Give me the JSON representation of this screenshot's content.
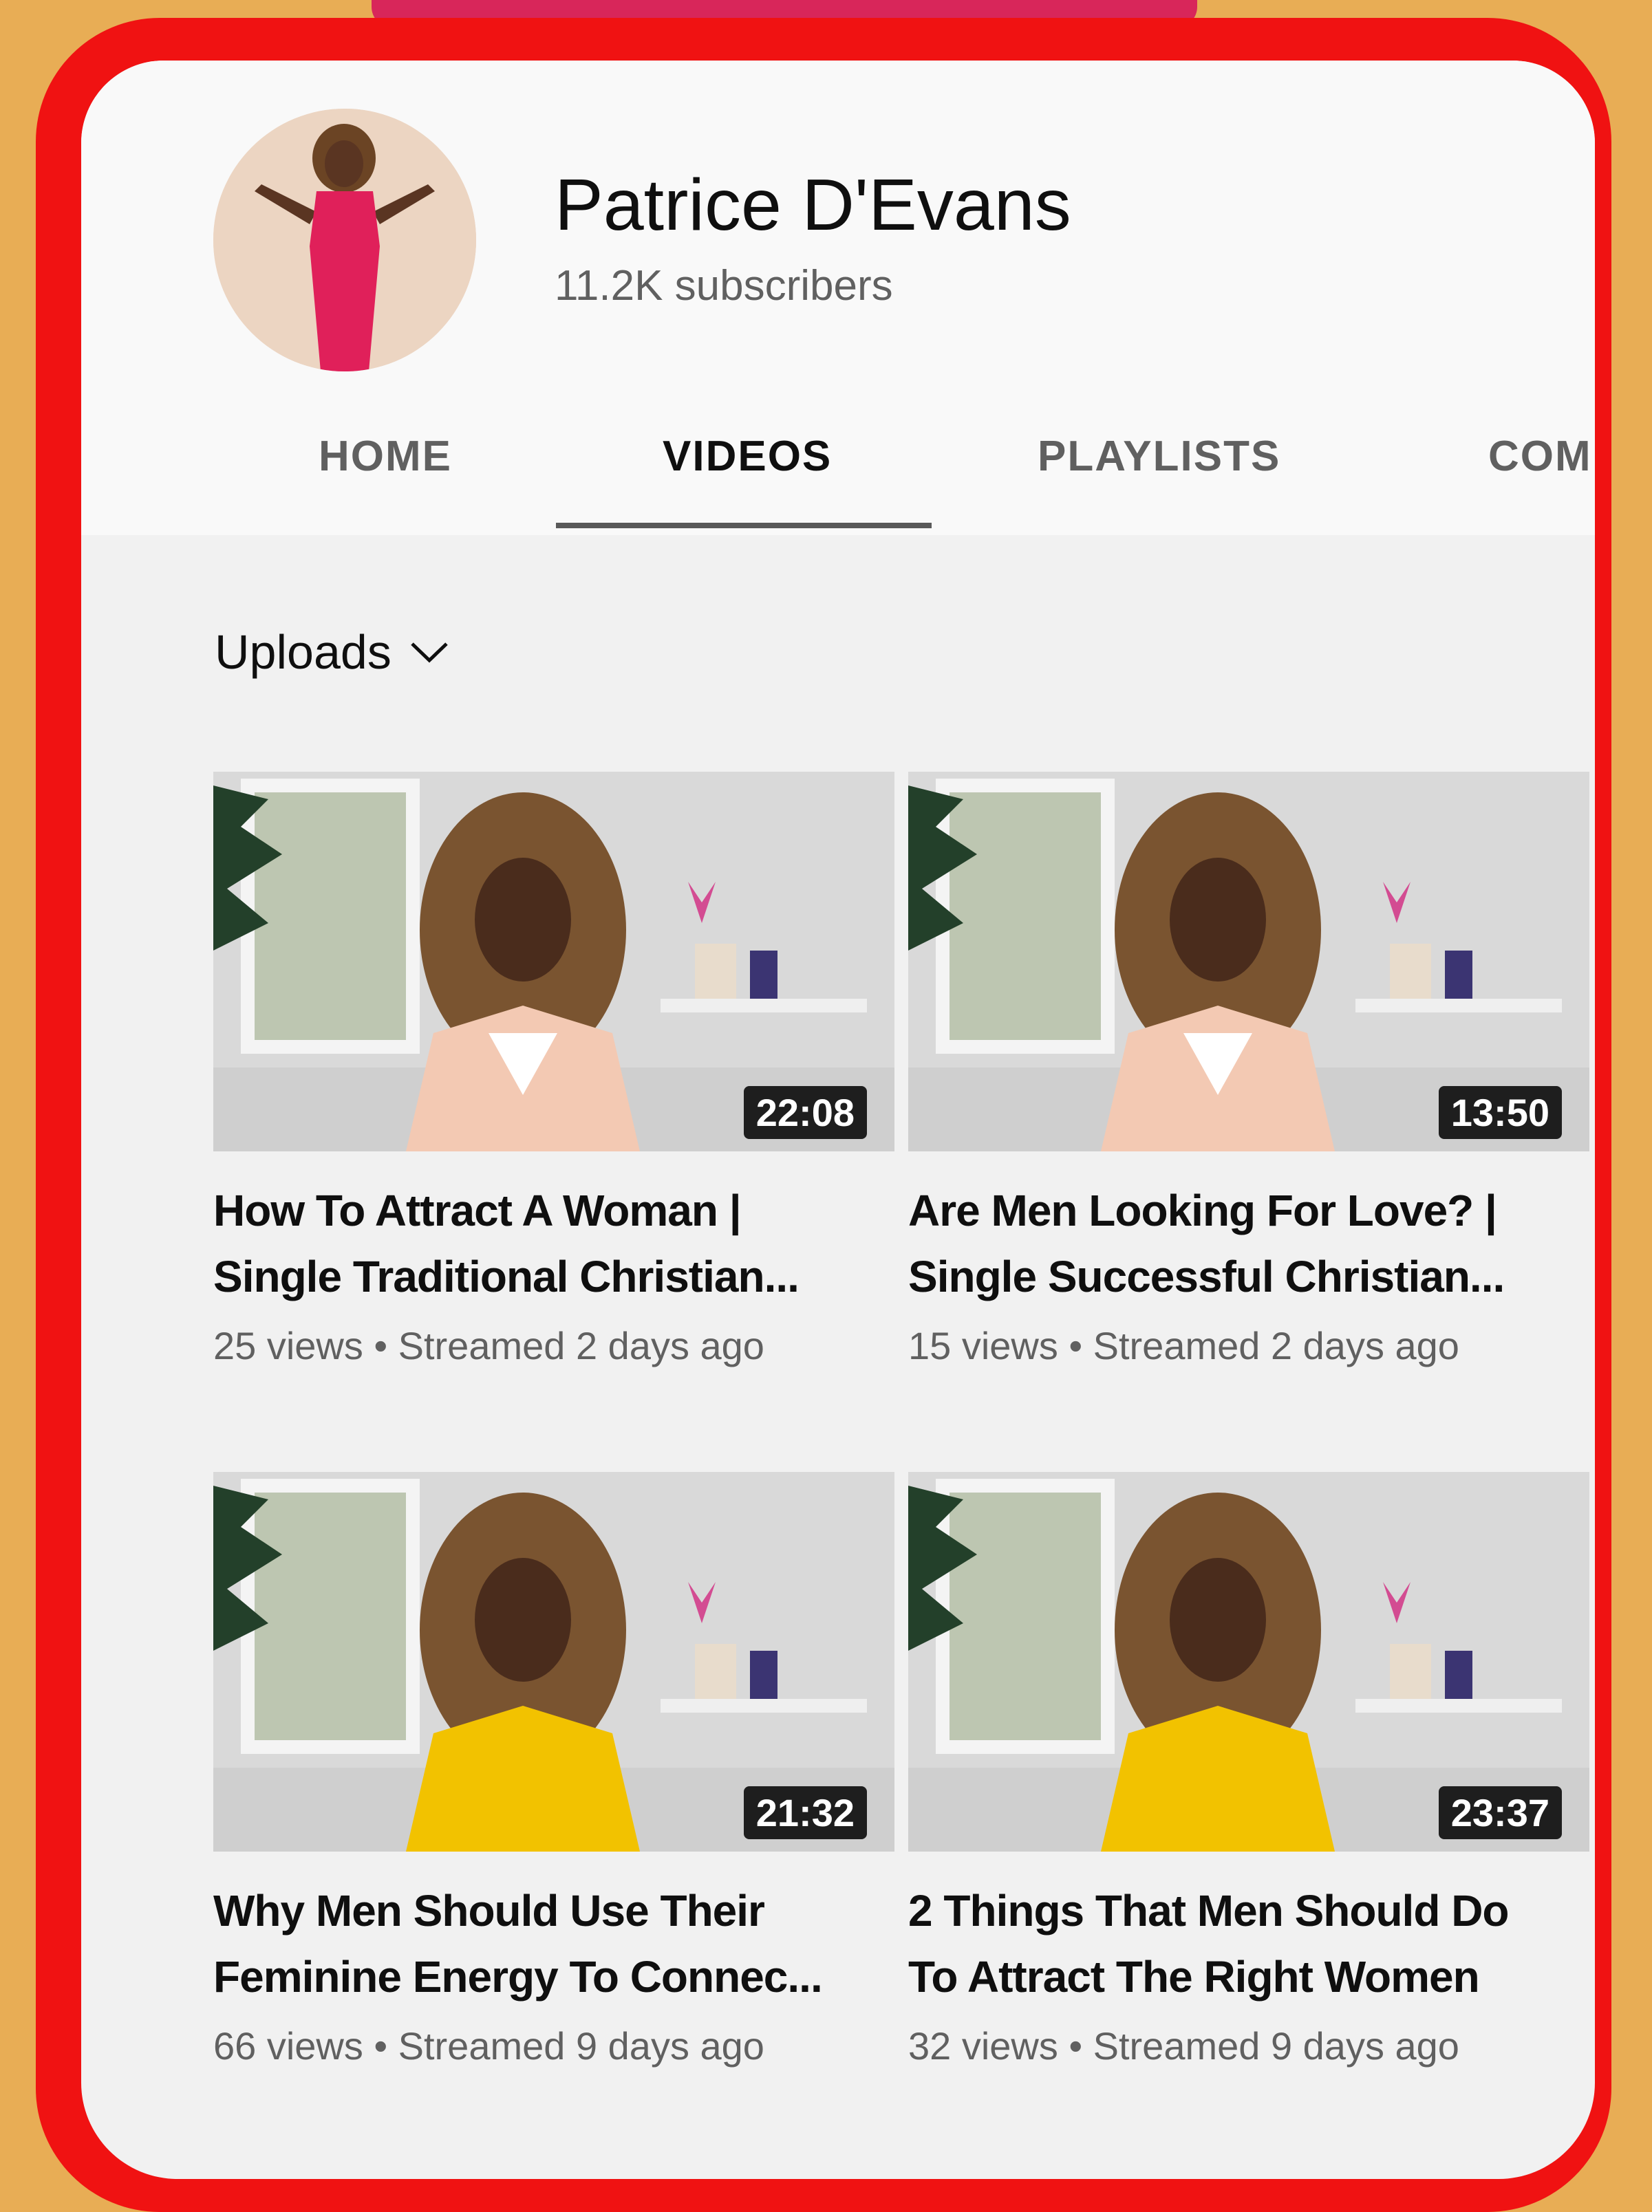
{
  "channel": {
    "name": "Patrice D'Evans",
    "subscribers": "11.2K subscribers"
  },
  "tabs": [
    {
      "label": "HOME",
      "active": false
    },
    {
      "label": "VIDEOS",
      "active": true
    },
    {
      "label": "PLAYLISTS",
      "active": false
    },
    {
      "label": "COM",
      "active": false
    }
  ],
  "section": {
    "label": "Uploads",
    "icon": "chevron-down-icon"
  },
  "videos": [
    {
      "duration": "22:08",
      "title_line1": "How To Attract A Woman |",
      "title_line2": "Single Traditional Christian...",
      "views": "25 views",
      "separator": "•",
      "streamed": "Streamed 2 days ago",
      "top_color": "#f3c9b3"
    },
    {
      "duration": "13:50",
      "title_line1": "Are Men Looking For Love? |",
      "title_line2": "Single Successful Christian...",
      "views": "15 views",
      "separator": "•",
      "streamed": "Streamed 2 days ago",
      "top_color": "#f3c9b3"
    },
    {
      "duration": "21:32",
      "title_line1": "Why Men Should Use Their",
      "title_line2": "Feminine Energy To Connec...",
      "views": "66 views",
      "separator": "•",
      "streamed": "Streamed 9 days ago",
      "top_color": "#f2c200"
    },
    {
      "duration": "23:37",
      "title_line1": "2 Things That Men Should Do",
      "title_line2": "To Attract The Right Women",
      "views": "32 views",
      "separator": "•",
      "streamed": "Streamed 9 days ago",
      "top_color": "#f2c200"
    }
  ],
  "colors": {
    "frame": "#f01212",
    "background": "#e8ad55",
    "avatar_dress": "#e0205a"
  }
}
